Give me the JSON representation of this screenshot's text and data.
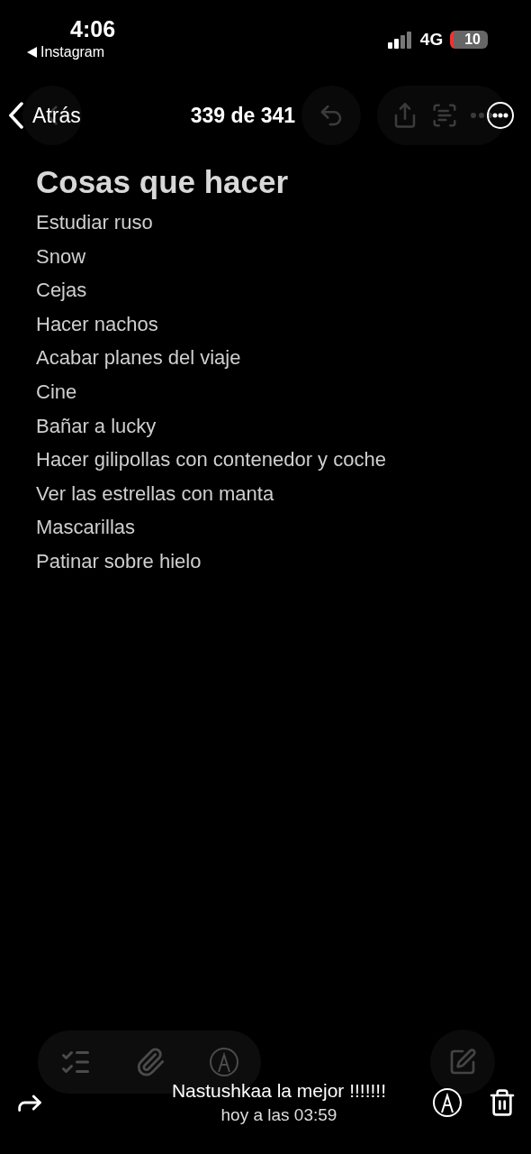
{
  "status_bar": {
    "time": "4:06",
    "back_app": "Instagram",
    "network": "4G",
    "battery": "10"
  },
  "viewer": {
    "back": "Atrás",
    "counter": "339 de 341",
    "caption": "Nastushkaa la mejor !!!!!!!",
    "date": "hoy a las 03:59"
  },
  "note": {
    "title": "Cosas que hacer",
    "items": [
      "Estudiar ruso",
      "Snow",
      "Cejas",
      "Hacer nachos",
      "Acabar planes del viaje",
      "Cine",
      "Bañar a lucky",
      "Hacer gilipollas con contenedor y coche",
      "Ver las estrellas con manta",
      "Mascarillas",
      "Patinar sobre hielo"
    ]
  }
}
